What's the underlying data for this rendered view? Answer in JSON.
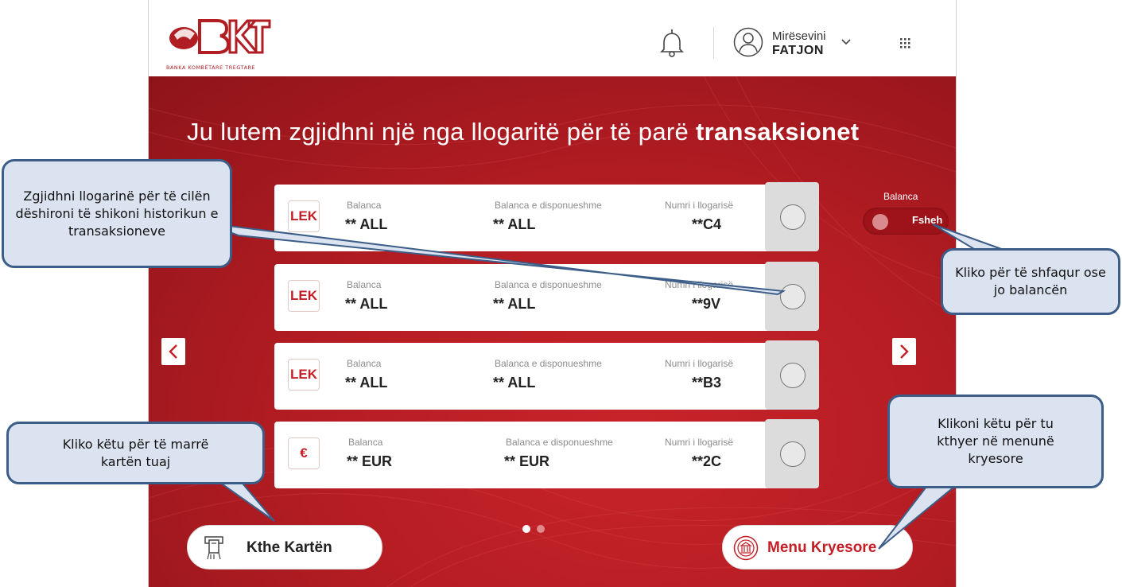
{
  "header": {
    "logo_text": "BKT",
    "logo_subtitle": "BANKA KOMBËTARE TREGTARE",
    "greeting": "Mirësevini",
    "user_name": "FATJON"
  },
  "main": {
    "title_regular": "Ju lutem zgjidhni një nga llogaritë për të parë ",
    "title_bold": "transaksionet"
  },
  "accounts": [
    {
      "currency_badge": "LEK",
      "balance_label": "Balanca",
      "balance_value": "** ALL",
      "available_label": "Balanca e disponueshme",
      "available_value": "** ALL",
      "number_label": "Numri i llogarisë",
      "number_value": "**C4"
    },
    {
      "currency_badge": "LEK",
      "balance_label": "Balanca",
      "balance_value": "** ALL",
      "available_label": "Balanca e disponueshme",
      "available_value": "** ALL",
      "number_label": "Numri i llogarisë",
      "number_value": "**9V"
    },
    {
      "currency_badge": "LEK",
      "balance_label": "Balanca",
      "balance_value": "** ALL",
      "available_label": "Balanca e disponueshme",
      "available_value": "** ALL",
      "number_label": "Numri i llogarisë",
      "number_value": "**B3"
    },
    {
      "currency_badge": "€",
      "balance_label": "Balanca",
      "balance_value": "** EUR",
      "available_label": "Balanca e disponueshme",
      "available_value": "** EUR",
      "number_label": "Numri i llogarisë",
      "number_value": "**2C"
    }
  ],
  "balance_toggle": {
    "label": "Balanca",
    "state_text": "Fsheh"
  },
  "pagination": {
    "total": 2,
    "active": 1
  },
  "actions": {
    "return_card": "Kthe Kartën",
    "main_menu": "Menu Kryesore"
  },
  "callouts": {
    "select_account": "Zgjidhni llogarinë për të cilën dëshironi të shikoni historikun e transaksioneve",
    "toggle_balance": "Kliko për të shfaqur ose jo balancën",
    "return_card": "Kliko këtu për të marrë kartën tuaj",
    "main_menu": "Klikoni këtu për tu kthyer në menunë kryesore"
  },
  "colors": {
    "brand_red": "#c41e25",
    "callout_fill": "#dbe3f0",
    "callout_border": "#3c5d87"
  }
}
